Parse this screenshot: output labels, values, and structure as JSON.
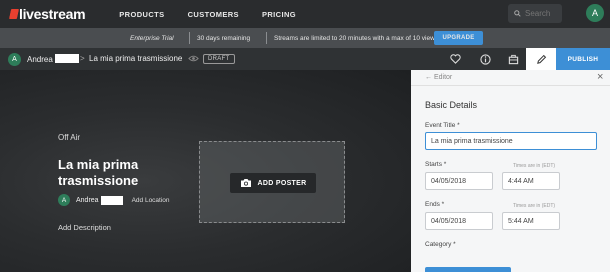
{
  "topnav": {
    "logo": "livestream",
    "links": [
      "PRODUCTS",
      "CUSTOMERS",
      "PRICING"
    ],
    "search_placeholder": "Search",
    "user_initial": "A"
  },
  "trial": {
    "plan": "Enterprise Trial",
    "days": "30 days remaining",
    "limit": "Streams are limited to 20 minutes with a max of 10 viewers.",
    "upgrade": "UPGRADE"
  },
  "eventbar": {
    "owner_initial": "A",
    "owner": "Andrea",
    "separator": ">",
    "title": "La mia prima trasmissione",
    "status": "DRAFT",
    "publish": "PUBLISH"
  },
  "main": {
    "status": "Off Air",
    "title": "La mia prima trasmissione",
    "host_initial": "A",
    "host": "Andrea",
    "add_location": "Add Location",
    "add_description": "Add Description",
    "add_poster": "ADD POSTER"
  },
  "editor": {
    "back": "Editor",
    "section": "Basic Details",
    "title_label": "Event Title *",
    "title_value": "La mia prima trasmissione",
    "starts_label": "Starts *",
    "starts_date": "04/05/2018",
    "starts_time": "4:44 AM",
    "timezone_note": "Times are in (EDT)",
    "ends_label": "Ends *",
    "ends_date": "04/05/2018",
    "ends_time": "5:44 AM",
    "category_label": "Category *"
  },
  "colors": {
    "accent": "#3d8fd6",
    "avatar": "#2e7d5a",
    "logo_mark": "#e8402f"
  }
}
